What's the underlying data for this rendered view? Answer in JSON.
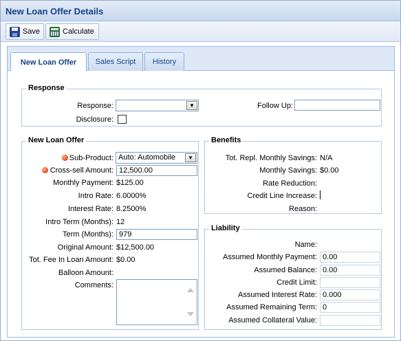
{
  "window": {
    "title": "New Loan Offer Details"
  },
  "toolbar": {
    "save_label": "Save",
    "calculate_label": "Calculate"
  },
  "tabs": [
    {
      "label": "New Loan Offer",
      "active": true
    },
    {
      "label": "Sales Script",
      "active": false
    },
    {
      "label": "History",
      "active": false
    }
  ],
  "response": {
    "legend": "Response",
    "response_label": "Response:",
    "response_value": "",
    "follow_up_label": "Follow Up:",
    "follow_up_value": "",
    "disclosure_label": "Disclosure:",
    "disclosure_checked": false
  },
  "new_loan_offer": {
    "legend": "New Loan Offer",
    "sub_product_label": "Sub-Product:",
    "sub_product_value": "Auto: Automobile",
    "cross_sell_label": "Cross-sell Amount:",
    "cross_sell_value": "12,500.00",
    "monthly_payment_label": "Monthly Payment:",
    "monthly_payment_value": "$125.00",
    "intro_rate_label": "Intro Rate:",
    "intro_rate_value": "6.0000%",
    "interest_rate_label": "Interest Rate:",
    "interest_rate_value": "8.2500%",
    "intro_term_label": "Intro Term (Months):",
    "intro_term_value": "12",
    "term_label": "Term (Months):",
    "term_value": "979",
    "original_amount_label": "Original Amount:",
    "original_amount_value": "$12,500.00",
    "tot_fee_label": "Tot. Fee In Loan Amount:",
    "tot_fee_value": "$0.00",
    "balloon_label": "Balloon Amount:",
    "balloon_value": "",
    "comments_label": "Comments:",
    "comments_value": ""
  },
  "benefits": {
    "legend": "Benefits",
    "tot_repl_label": "Tot. Repl. Monthly Savings:",
    "tot_repl_value": "N/A",
    "monthly_savings_label": "Monthly Savings:",
    "monthly_savings_value": "$0.00",
    "rate_reduction_label": "Rate Reduction:",
    "rate_reduction_value": "",
    "credit_line_label": "Credit Line Increase:",
    "credit_line_value": "",
    "reason_label": "Reason:",
    "reason_value": ""
  },
  "liability": {
    "legend": "Liability",
    "name_label": "Name:",
    "name_value": "",
    "assumed_monthly_payment_label": "Assumed Monthly Payment:",
    "assumed_monthly_payment_value": "0.00",
    "assumed_balance_label": "Assumed Balance:",
    "assumed_balance_value": "0.00",
    "credit_limit_label": "Credit Limit:",
    "credit_limit_value": "",
    "assumed_interest_rate_label": "Assumed Interest Rate:",
    "assumed_interest_rate_value": "0.000",
    "assumed_remaining_term_label": "Assumed Remaining Term:",
    "assumed_remaining_term_value": "0",
    "assumed_collateral_label": "Assumed Collateral Value:",
    "assumed_collateral_value": ""
  },
  "colors": {
    "title": "#15428b",
    "panel_bg": "#dfe8f6",
    "required_dot": "#e4552a"
  },
  "icons": {
    "save": "floppy-disk-icon",
    "calculate": "calculator-icon",
    "required": "required-dot-icon"
  }
}
